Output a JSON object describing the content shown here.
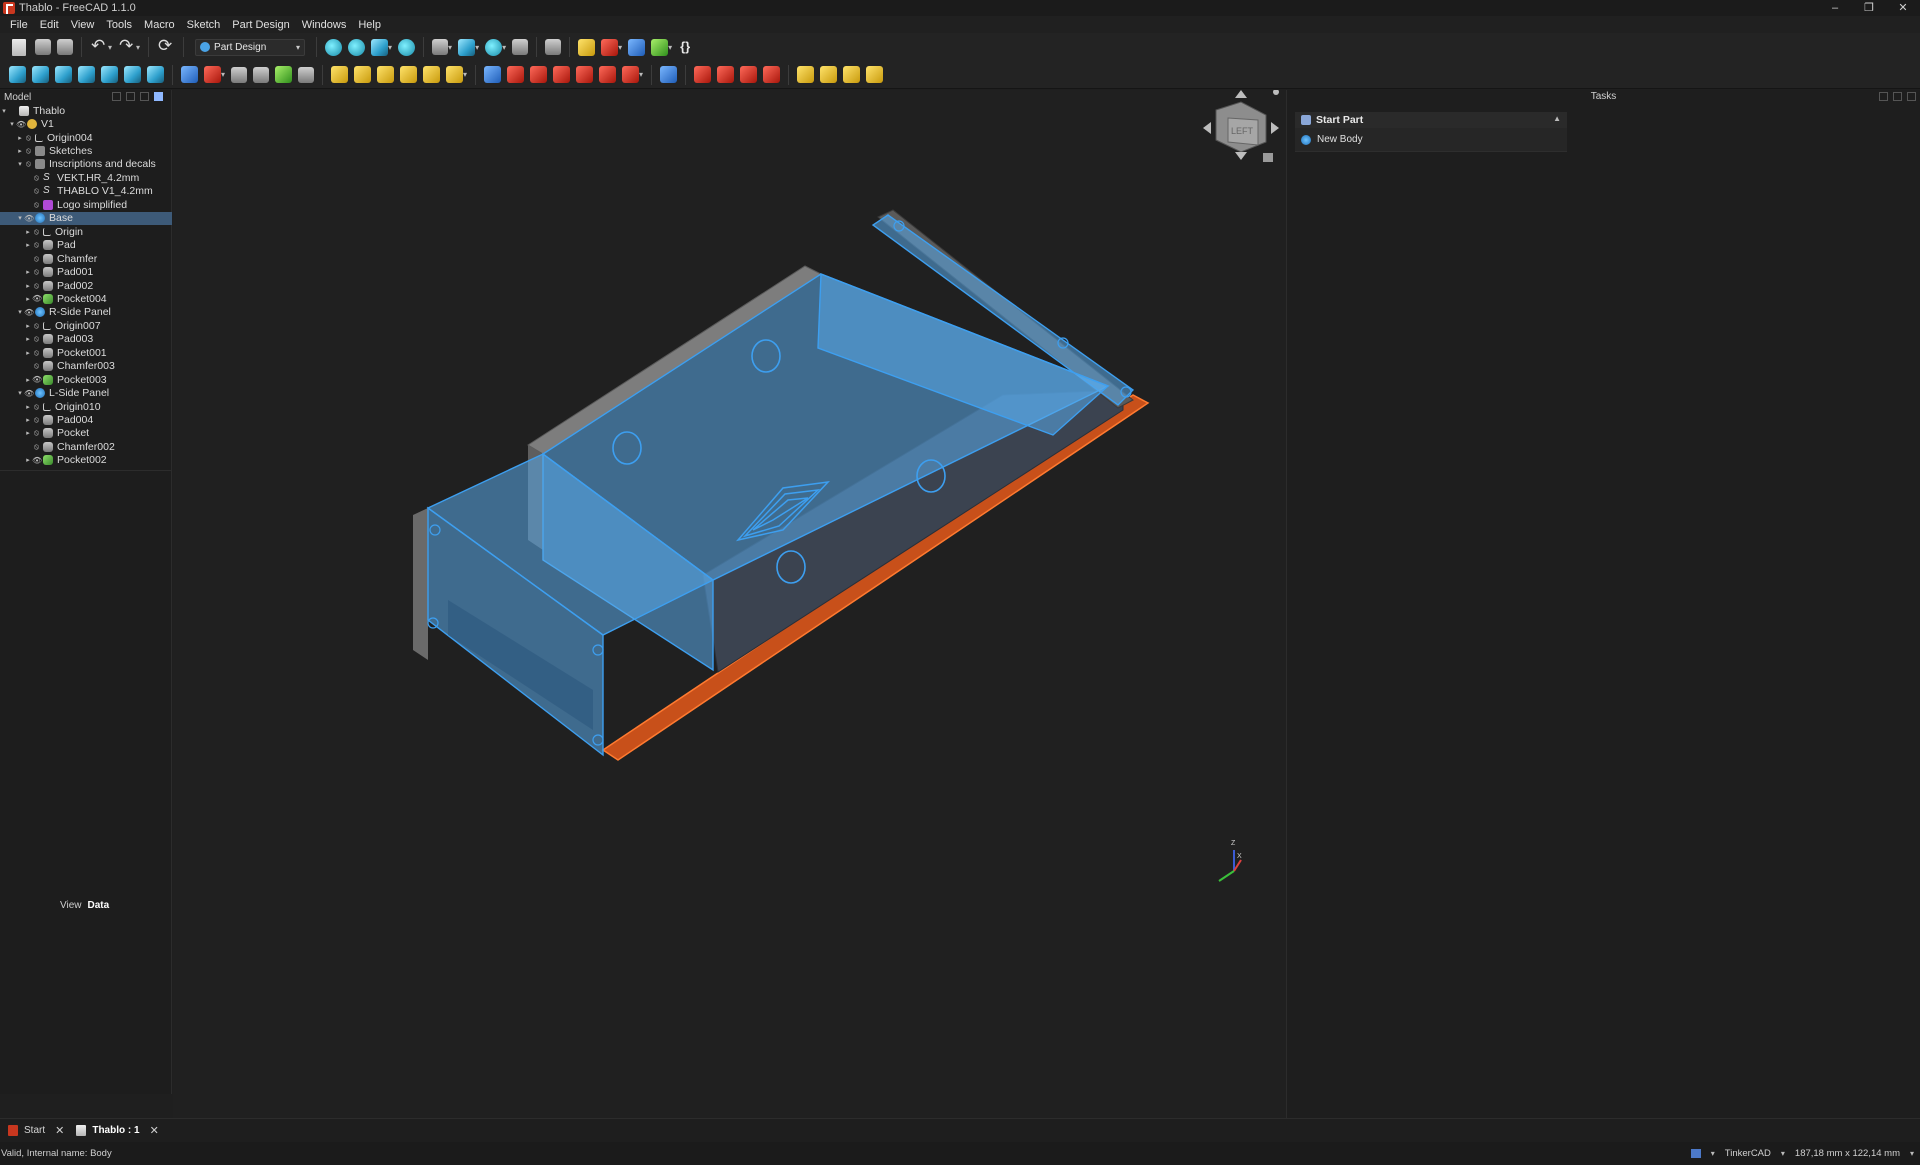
{
  "window": {
    "title": "Thablo - FreeCAD 1.1.0",
    "controls": [
      "–",
      "❐",
      "✕"
    ]
  },
  "menu": [
    "File",
    "Edit",
    "View",
    "Tools",
    "Macro",
    "Sketch",
    "Part Design",
    "Windows",
    "Help"
  ],
  "toolbar": {
    "workbench": "Part Design"
  },
  "model_panel": {
    "title": "Model",
    "tree": [
      {
        "label": "Thablo",
        "icon": "document-icon",
        "expand": "▾",
        "vis": "",
        "indent": 0
      },
      {
        "label": "V1",
        "icon": "part-icon",
        "expand": "▾",
        "vis": "👁",
        "indent": 1
      },
      {
        "label": "Origin004",
        "icon": "origin-icon",
        "expand": "▸",
        "vis": "⦸",
        "indent": 2
      },
      {
        "label": "Sketches",
        "icon": "folder-icon",
        "expand": "▸",
        "vis": "⦸",
        "indent": 2
      },
      {
        "label": "Inscriptions and decals",
        "icon": "folder-icon",
        "expand": "▾",
        "vis": "⦸",
        "indent": 2
      },
      {
        "label": "VEKT.HR_4.2mm",
        "icon": "shapestring-icon",
        "expand": "",
        "vis": "⦸",
        "indent": 3
      },
      {
        "label": "THABLO V1_4.2mm",
        "icon": "shapestring-icon",
        "expand": "",
        "vis": "⦸",
        "indent": 3
      },
      {
        "label": "Logo simplified",
        "icon": "logo-icon",
        "expand": "",
        "vis": "⦸",
        "indent": 3
      },
      {
        "label": "Base",
        "icon": "body-icon",
        "expand": "▾",
        "vis": "👁",
        "indent": 2,
        "selected": true
      },
      {
        "label": "Origin",
        "icon": "origin-icon",
        "expand": "▸",
        "vis": "⦸",
        "indent": 3
      },
      {
        "label": "Pad",
        "icon": "feature-icon",
        "expand": "▸",
        "vis": "⦸",
        "indent": 3
      },
      {
        "label": "Chamfer",
        "icon": "feature-icon",
        "expand": "",
        "vis": "⦸",
        "indent": 3
      },
      {
        "label": "Pad001",
        "icon": "feature-icon",
        "expand": "▸",
        "vis": "⦸",
        "indent": 3
      },
      {
        "label": "Pad002",
        "icon": "feature-icon",
        "expand": "▸",
        "vis": "⦸",
        "indent": 3
      },
      {
        "label": "Pocket004",
        "icon": "pocket-icon",
        "expand": "▸",
        "vis": "👁",
        "indent": 3
      },
      {
        "label": "R-Side Panel",
        "icon": "body-icon",
        "expand": "▾",
        "vis": "👁",
        "indent": 2
      },
      {
        "label": "Origin007",
        "icon": "origin-icon",
        "expand": "▸",
        "vis": "⦸",
        "indent": 3
      },
      {
        "label": "Pad003",
        "icon": "feature-icon",
        "expand": "▸",
        "vis": "⦸",
        "indent": 3
      },
      {
        "label": "Pocket001",
        "icon": "feature-icon",
        "expand": "▸",
        "vis": "⦸",
        "indent": 3
      },
      {
        "label": "Chamfer003",
        "icon": "feature-icon",
        "expand": "",
        "vis": "⦸",
        "indent": 3
      },
      {
        "label": "Pocket003",
        "icon": "pocket-icon",
        "expand": "▸",
        "vis": "👁",
        "indent": 3
      },
      {
        "label": "L-Side Panel",
        "icon": "body-icon",
        "expand": "▾",
        "vis": "👁",
        "indent": 2
      },
      {
        "label": "Origin010",
        "icon": "origin-icon",
        "expand": "▸",
        "vis": "⦸",
        "indent": 3
      },
      {
        "label": "Pad004",
        "icon": "feature-icon",
        "expand": "▸",
        "vis": "⦸",
        "indent": 3
      },
      {
        "label": "Pocket",
        "icon": "feature-icon",
        "expand": "▸",
        "vis": "⦸",
        "indent": 3
      },
      {
        "label": "Chamfer002",
        "icon": "feature-icon",
        "expand": "",
        "vis": "⦸",
        "indent": 3
      },
      {
        "label": "Pocket002",
        "icon": "pocket-icon",
        "expand": "▸",
        "vis": "👁",
        "indent": 3
      }
    ],
    "property_tabs": [
      "View",
      "Data"
    ],
    "active_property_tab": "Data"
  },
  "tasks_panel": {
    "title": "Tasks",
    "section_title": "Start Part",
    "action": "New Body"
  },
  "navcube": {
    "face_label": "LEFT"
  },
  "axis_triad": {
    "labels": [
      "Z",
      "X"
    ]
  },
  "doc_tabs": [
    {
      "label": "Start",
      "icon": "freecad-icon",
      "active": false
    },
    {
      "label": "Thablo : 1",
      "icon": "document-icon",
      "active": true
    }
  ],
  "status": {
    "message": "Valid, Internal name: Body",
    "navigation_style": "TinkerCAD",
    "dimensions": "187,18 mm x 122,14 mm"
  },
  "colors": {
    "selection_blue": "#4aa3f0",
    "base_orange": "#c8501a",
    "panel_gray": "#6a6a6a",
    "background": "#202020"
  }
}
